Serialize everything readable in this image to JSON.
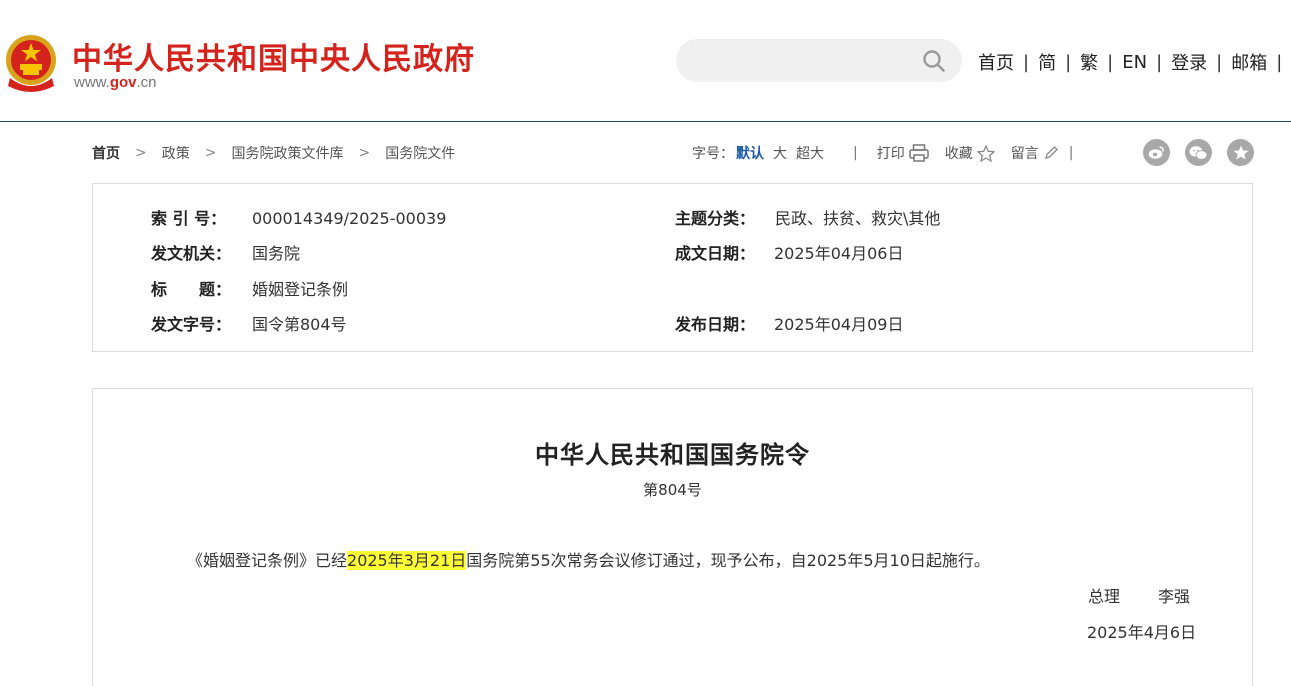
{
  "header": {
    "site_title": "中华人民共和国中央人民政府",
    "url_prefix": "www.",
    "url_gov": "gov",
    "url_suffix": ".cn",
    "search_placeholder": "",
    "nav": [
      "首页",
      "简",
      "繁",
      "EN",
      "登录",
      "邮箱"
    ],
    "nav_separator": "|"
  },
  "breadcrumb": {
    "items": [
      "首页",
      "政策",
      "国务院政策文件库",
      "国务院文件"
    ],
    "separator": ">"
  },
  "toolbar": {
    "font_size_label": "字号：",
    "font_sizes": [
      "默认",
      "大",
      "超大"
    ],
    "active_font_size": "默认",
    "separator": "|",
    "print_label": "打印",
    "favorite_label": "收藏",
    "comment_label": "留言"
  },
  "meta": {
    "index_label": "索 引 号：",
    "index_value": "000014349/2025-00039",
    "subject_label": "主题分类：",
    "subject_value": "民政、扶贫、救灾\\其他",
    "issuer_label": "发文机关：",
    "issuer_value": "国务院",
    "written_date_label": "成文日期：",
    "written_date_value": "2025年04月06日",
    "title_label": "标　　题：",
    "title_value": "婚姻登记条例",
    "doc_no_label": "发文字号：",
    "doc_no_value": "国令第804号",
    "publish_date_label": "发布日期：",
    "publish_date_value": "2025年04月09日"
  },
  "document": {
    "title": "中华人民共和国国务院令",
    "number": "第804号",
    "para_before": "《婚姻登记条例》已经",
    "para_highlight": "2025年3月21日",
    "para_after": "国务院第55次常务会议修订通过，现予公布，自2025年5月10日起施行。",
    "signer_role": "总理",
    "signer_name": "李强",
    "sign_date": "2025年4月6日"
  },
  "colors": {
    "brand_red": "#d4231c",
    "link_blue": "#1a5aa6",
    "highlight": "#ffff33",
    "share_gray": "#a8a8a8"
  },
  "icons": [
    "national-emblem-icon",
    "search-icon",
    "printer-icon",
    "star-icon",
    "pencil-icon",
    "weibo-icon",
    "wechat-icon",
    "favorite-star-icon"
  ]
}
